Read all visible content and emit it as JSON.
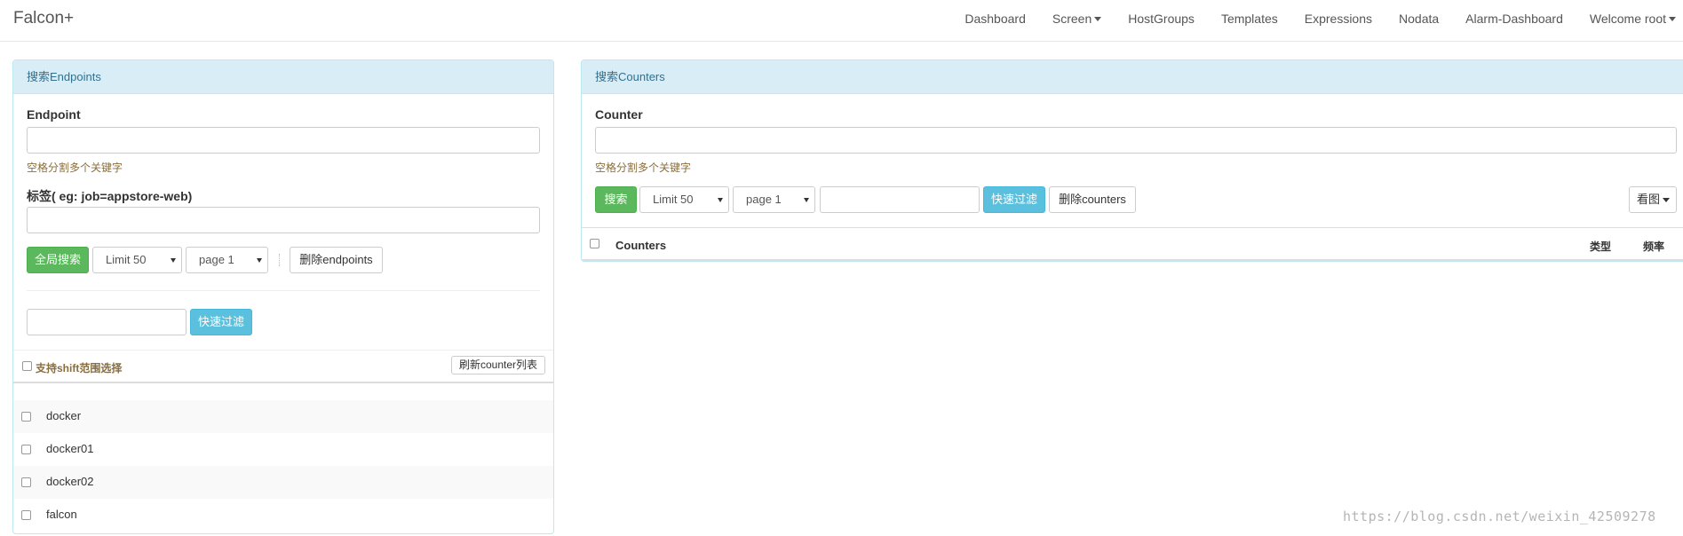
{
  "navbar": {
    "brand": "Falcon+",
    "items": [
      {
        "label": "Dashboard",
        "dropdown": false
      },
      {
        "label": "Screen",
        "dropdown": true
      },
      {
        "label": "HostGroups",
        "dropdown": false
      },
      {
        "label": "Templates",
        "dropdown": false
      },
      {
        "label": "Expressions",
        "dropdown": false
      },
      {
        "label": "Nodata",
        "dropdown": false
      },
      {
        "label": "Alarm-Dashboard",
        "dropdown": false
      },
      {
        "label": "Welcome root",
        "dropdown": true
      }
    ]
  },
  "endpoints_panel": {
    "title": "搜索Endpoints",
    "endpoint_label": "Endpoint",
    "endpoint_value": "",
    "endpoint_help": "空格分割多个关键字",
    "tag_label": "标签( eg: job=appstore-web)",
    "tag_value": "",
    "search_button": "全局搜索",
    "limit_select": "Limit 50",
    "page_select": "page 1",
    "delete_button": "删除endpoints",
    "filter_value": "",
    "filter_button": "快速过滤",
    "shift_select_label": "支持shift范围选择",
    "refresh_button": "刷新counter列表",
    "endpoints": [
      "docker",
      "docker01",
      "docker02",
      "falcon"
    ]
  },
  "counters_panel": {
    "title": "搜索Counters",
    "counter_label": "Counter",
    "counter_value": "",
    "counter_help": "空格分割多个关键字",
    "search_button": "搜索",
    "limit_select": "Limit 50",
    "page_select": "page 1",
    "filter_value": "",
    "filter_button": "快速过滤",
    "delete_button": "删除counters",
    "view_button": "看图",
    "table_headers": {
      "counters": "Counters",
      "type": "类型",
      "freq": "频率"
    }
  },
  "watermark": "https://blog.csdn.net/weixin_42509278",
  "colors": {
    "panel_heading_bg": "#d9edf7",
    "panel_border": "#bce8f1",
    "success": "#5cb85c",
    "info": "#5bc0de",
    "help_text": "#8a6d3b"
  }
}
